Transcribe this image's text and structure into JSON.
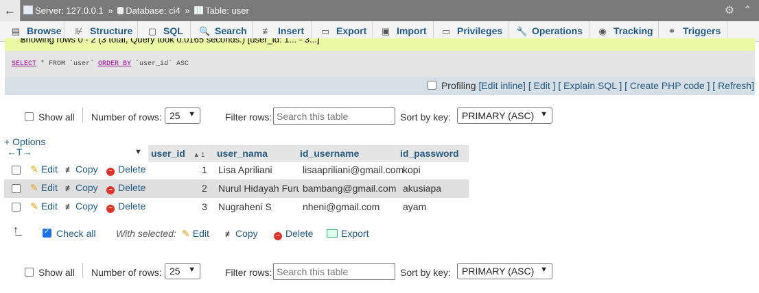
{
  "breadcrumb": {
    "back": "←",
    "server": "Server: 127.0.0.1",
    "database": "Database: ci4",
    "table": "Table: user",
    "separator": "»"
  },
  "topbar_icons": {
    "settings": "⚙",
    "collapse": "⌃"
  },
  "tabs": [
    {
      "label": "Browse",
      "icon": "browse-icon"
    },
    {
      "label": "Structure",
      "icon": "structure-icon"
    },
    {
      "label": "SQL",
      "icon": "sql-icon"
    },
    {
      "label": "Search",
      "icon": "search-icon"
    },
    {
      "label": "Insert",
      "icon": "insert-icon"
    },
    {
      "label": "Export",
      "icon": "export-icon"
    },
    {
      "label": "Import",
      "icon": "import-icon"
    },
    {
      "label": "Privileges",
      "icon": "privileges-icon"
    },
    {
      "label": "Operations",
      "icon": "operations-icon"
    },
    {
      "label": "Tracking",
      "icon": "tracking-icon"
    },
    {
      "label": "Triggers",
      "icon": "triggers-icon"
    }
  ],
  "message": "Showing rows 0 - 2 (3 total, Query took 0.0165 seconds.) [user_id: 1... - 3...]",
  "sql": {
    "select": "SELECT",
    "rest_a": " * FROM `user` ",
    "order": "ORDER BY",
    "rest_b": " `user_id` ASC"
  },
  "profiling": {
    "label": "Profiling",
    "links": [
      "[Edit inline]",
      "[ Edit ]",
      "[ Explain SQL ]",
      "[ Create PHP code ]",
      "[ Refresh]"
    ]
  },
  "nav": {
    "show_all": "Show all",
    "number_of_rows_label": "Number of rows:",
    "rows_value": "25",
    "filter_label": "Filter rows:",
    "filter_placeholder": "Search this table",
    "sort_label": "Sort by key:",
    "sort_value": "PRIMARY (ASC)"
  },
  "table": {
    "options": "+ Options",
    "column_arrows": "←T→",
    "columns": [
      "user_id",
      "user_nama",
      "id_username",
      "id_password"
    ],
    "sort_indicator": "▲ 1",
    "row_actions": {
      "edit": "Edit",
      "copy": "Copy",
      "delete": "Delete"
    },
    "rows": [
      {
        "user_id": "1",
        "user_nama": "Lisa Apriliani",
        "id_username": "lisaapriliani@gmail.com",
        "id_password": "kopi"
      },
      {
        "user_id": "2",
        "user_nama": "Nurul Hidayah Furu",
        "id_username": "bambang@gmail.com",
        "id_password": "akusiapa"
      },
      {
        "user_id": "3",
        "user_nama": "Nugraheni S",
        "id_username": "nheni@gmail.com",
        "id_password": "ayam"
      }
    ]
  },
  "bulk": {
    "check_all": "Check all",
    "with_selected": "With selected:",
    "edit": "Edit",
    "copy": "Copy",
    "delete": "Delete",
    "export": "Export"
  },
  "colors": {
    "link": "#235a81",
    "message_bg": "#ebf8a4",
    "topbar": "#7a7a7a"
  }
}
